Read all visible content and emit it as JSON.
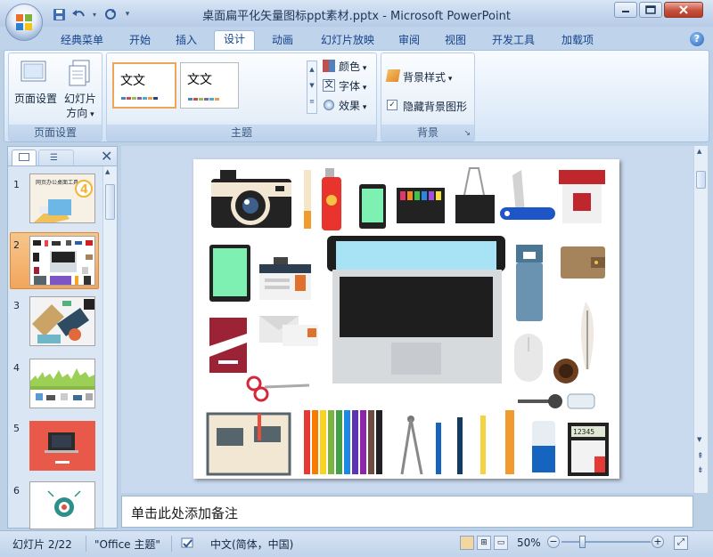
{
  "window": {
    "title": "桌面扁平化矢量图标ppt素材.pptx - Microsoft PowerPoint"
  },
  "qat": {
    "save_icon": "save-icon",
    "undo_icon": "undo-icon",
    "redo_icon": "redo-icon",
    "customize_icon": "customize-qat-icon"
  },
  "tabs": [
    "经典菜单",
    "开始",
    "插入",
    "设计",
    "动画",
    "幻灯片放映",
    "审阅",
    "视图",
    "开发工具",
    "加载项"
  ],
  "active_tab": "设计",
  "ribbon": {
    "page_setup": {
      "btn1": "页面设置",
      "btn2_line1": "幻灯片",
      "btn2_line2": "方向",
      "group": "页面设置"
    },
    "themes": {
      "thumb1": "文文",
      "thumb1_text": "文文",
      "thumb2_text": "文文",
      "colors": "颜色",
      "fonts": "字体",
      "effects": "效果",
      "group": "主题"
    },
    "background": {
      "styles": "背景样式",
      "hide": "隐藏背景图形",
      "group": "背景"
    }
  },
  "slides_panel": {
    "count": 6,
    "numbers": [
      "1",
      "2",
      "3",
      "4",
      "5",
      "6"
    ],
    "selected": 2,
    "slide1_badge": "4",
    "slide1_title": "网页办公桌面工具"
  },
  "slide": {
    "calc_display": "12345"
  },
  "notes": {
    "placeholder": "单击此处添加备注"
  },
  "status": {
    "slide": "幻灯片 2/22",
    "theme": "\"Office 主题\"",
    "lang": "中文(简体，中国)",
    "zoom": "50%"
  },
  "colors": {
    "accent": "#f0a458",
    "ribbon": "#dbe7f6",
    "frame": "#bcd0e6"
  }
}
